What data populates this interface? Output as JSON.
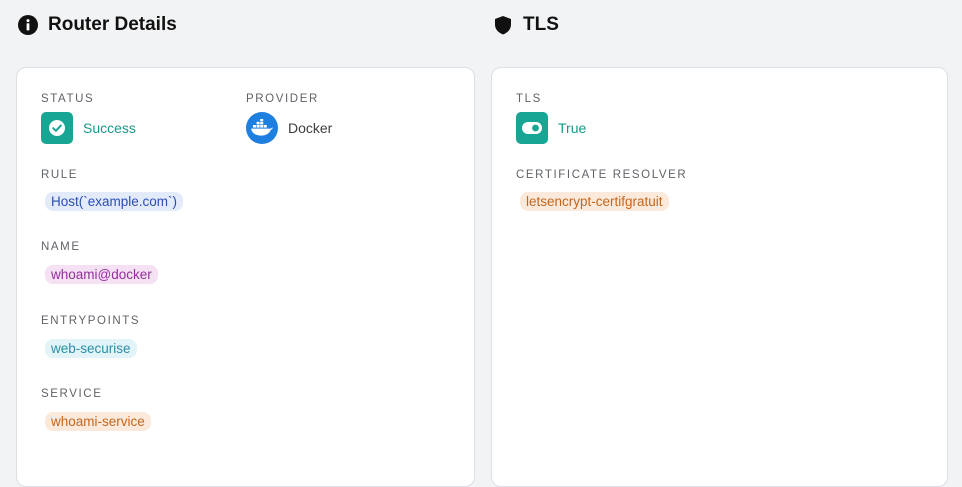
{
  "router_details": {
    "title": "Router Details",
    "status_label": "STATUS",
    "status_value": "Success",
    "provider_label": "PROVIDER",
    "provider_value": "Docker",
    "rule_label": "RULE",
    "rule_value": "Host(`example.com`)",
    "name_label": "NAME",
    "name_value": "whoami@docker",
    "entrypoints_label": "ENTRYPOINTS",
    "entrypoints_value": "web-securise",
    "service_label": "SERVICE",
    "service_value": "whoami-service"
  },
  "tls": {
    "title": "TLS",
    "tls_label": "TLS",
    "tls_value": "True",
    "resolver_label": "CERTIFICATE RESOLVER",
    "resolver_value": "letsencrypt-certifgratuit"
  },
  "colors": {
    "success_green": "#18a594",
    "docker_blue": "#1d7fe0",
    "background": "#f2f3f5"
  },
  "icons": {
    "router_details": "info-circle-icon",
    "tls": "shield-icon",
    "status": "check-circle-icon",
    "provider": "docker-icon",
    "tls_value": "toggle-on-icon"
  }
}
